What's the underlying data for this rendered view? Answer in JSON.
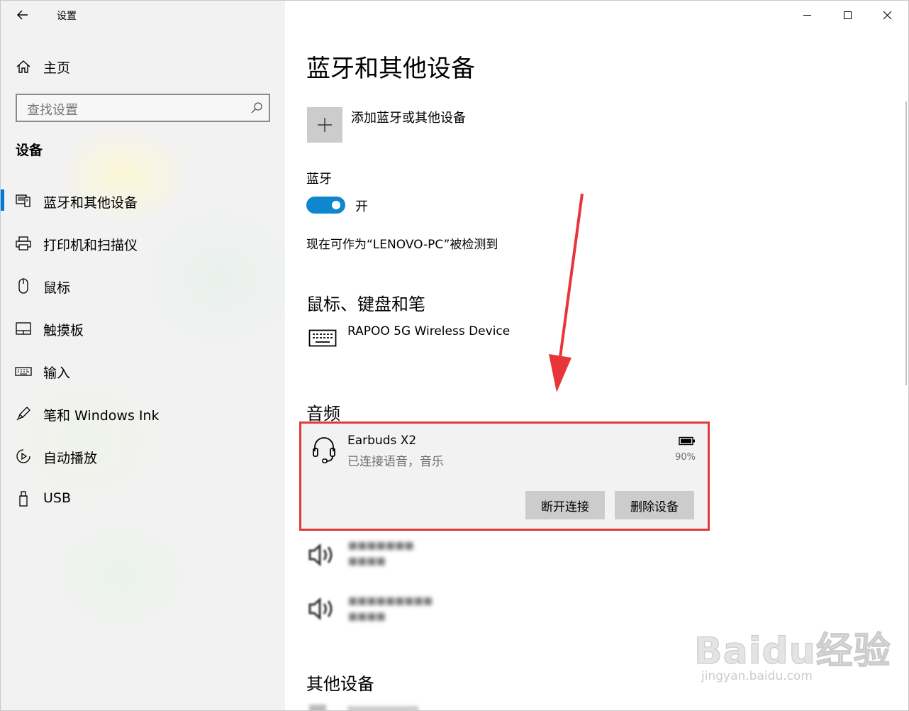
{
  "window": {
    "title": "设置",
    "controls": [
      "minimize-icon",
      "maximize-icon",
      "close-icon"
    ]
  },
  "sidebar": {
    "home_label": "主页",
    "search_placeholder": "查找设置",
    "section_heading": "设备",
    "items": [
      {
        "label": "蓝牙和其他设备",
        "icon": "bluetooth-devices-icon",
        "active": true
      },
      {
        "label": "打印机和扫描仪",
        "icon": "printer-icon",
        "active": false
      },
      {
        "label": "鼠标",
        "icon": "mouse-icon",
        "active": false
      },
      {
        "label": "触摸板",
        "icon": "touchpad-icon",
        "active": false
      },
      {
        "label": "输入",
        "icon": "keyboard-icon",
        "active": false
      },
      {
        "label": "笔和 Windows Ink",
        "icon": "pen-icon",
        "active": false
      },
      {
        "label": "自动播放",
        "icon": "autoplay-icon",
        "active": false
      },
      {
        "label": "USB",
        "icon": "usb-icon",
        "active": false
      }
    ]
  },
  "main": {
    "title": "蓝牙和其他设备",
    "add_device_label": "添加蓝牙或其他设备",
    "bluetooth_label": "蓝牙",
    "bluetooth_state": "开",
    "bluetooth_on": true,
    "discoverable_text": "现在可作为“LENOVO-PC”被检测到",
    "mouse_group": {
      "heading": "鼠标、键盘和笔",
      "device_name": "RAPOO 5G Wireless Device"
    },
    "audio_group": {
      "heading": "音频",
      "selected_device": {
        "name": "Earbuds X2",
        "status": "已连接语音，音乐",
        "battery": "90%",
        "disconnect_label": "断开连接",
        "remove_label": "删除设备"
      }
    },
    "other_group": {
      "heading": "其他设备"
    }
  },
  "watermark": {
    "logo_text": "Baidu经验",
    "url": "jingyan.baidu.com"
  },
  "colors": {
    "accent": "#0078d7",
    "toggle_on": "#0f87cf",
    "highlight_border": "#e53838",
    "annotation_arrow": "#e8353a",
    "button_bg": "#cccccc",
    "sidebar_bg": "#f2f2f2"
  }
}
